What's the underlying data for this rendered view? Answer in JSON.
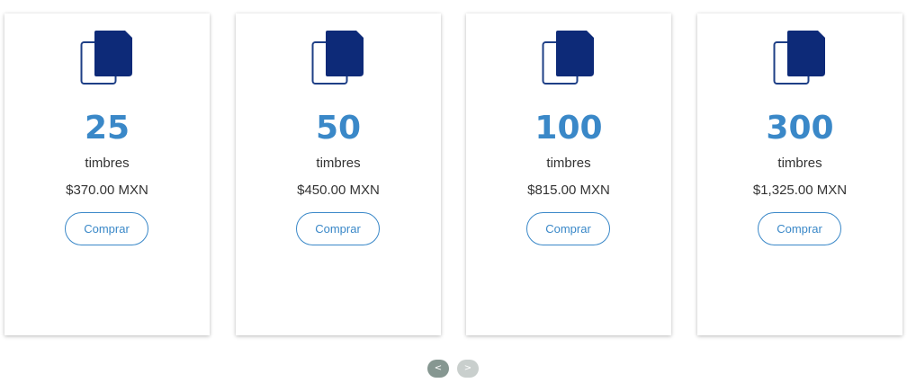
{
  "colors": {
    "accent": "#3a88c8",
    "icon_dark": "#0d2a78",
    "nav_active": "#869791",
    "nav_inactive": "#c9cfcd"
  },
  "packages": [
    {
      "quantity": "25",
      "unit": "timbres",
      "price": "$370.00 MXN",
      "button_label": "Comprar",
      "icon": "documents-icon"
    },
    {
      "quantity": "50",
      "unit": "timbres",
      "price": "$450.00 MXN",
      "button_label": "Comprar",
      "icon": "documents-icon"
    },
    {
      "quantity": "100",
      "unit": "timbres",
      "price": "$815.00 MXN",
      "button_label": "Comprar",
      "icon": "documents-icon"
    },
    {
      "quantity": "300",
      "unit": "timbres",
      "price": "$1,325.00 MXN",
      "button_label": "Comprar",
      "icon": "documents-icon"
    }
  ],
  "carousel": {
    "prev_label": "<",
    "next_label": ">"
  }
}
